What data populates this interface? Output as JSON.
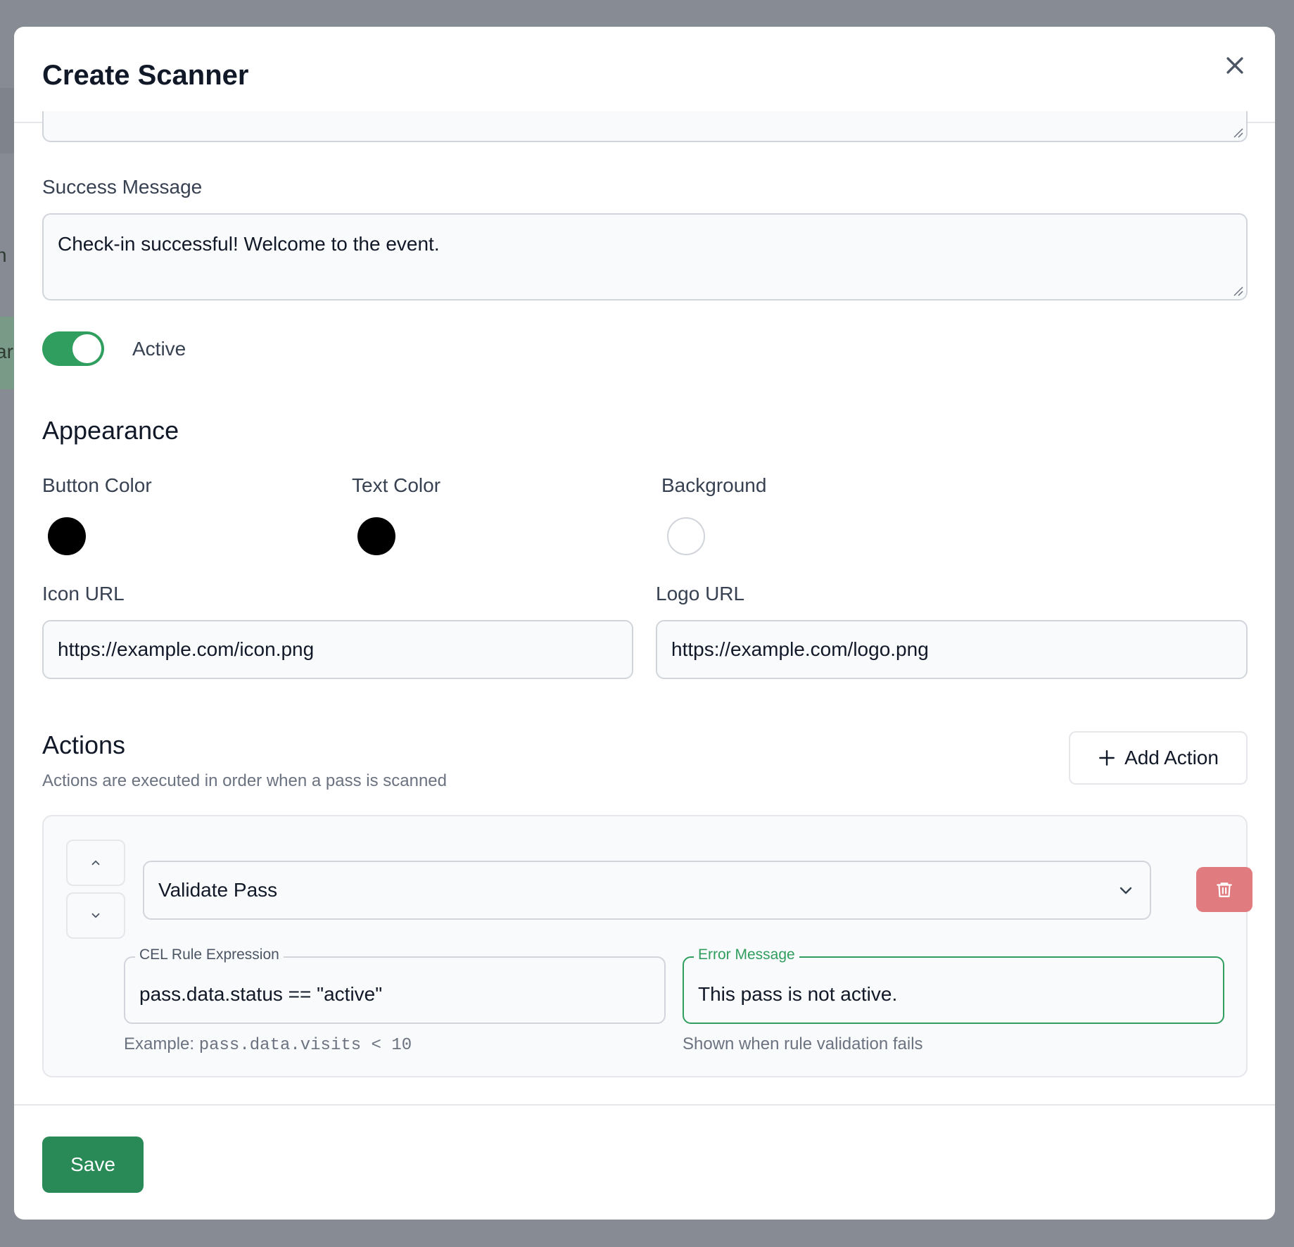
{
  "backdrop": {
    "fragment_1": "n",
    "fragment_2": "ar"
  },
  "modal": {
    "title": "Create Scanner",
    "close_icon": "close-icon"
  },
  "success_message": {
    "label": "Success Message",
    "value": "Check-in successful! Welcome to the event."
  },
  "active_toggle": {
    "label": "Active",
    "on": true,
    "color": "#2f9e5e"
  },
  "appearance": {
    "title": "Appearance",
    "button_color": {
      "label": "Button Color",
      "value": "#000000"
    },
    "text_color": {
      "label": "Text Color",
      "value": "#000000"
    },
    "background": {
      "label": "Background",
      "value": "#ffffff"
    },
    "icon_url": {
      "label": "Icon URL",
      "value": "https://example.com/icon.png"
    },
    "logo_url": {
      "label": "Logo URL",
      "value": "https://example.com/logo.png"
    }
  },
  "actions": {
    "title": "Actions",
    "subtitle": "Actions are executed in order when a pass is scanned",
    "add_button": "Add Action",
    "items": [
      {
        "type": "Validate Pass",
        "rule_label": "CEL Rule Expression",
        "rule_value": "pass.data.status == \"active\"",
        "rule_helper_prefix": "Example: ",
        "rule_helper_code": "pass.data.visits < 10",
        "error_label": "Error Message",
        "error_value": "This pass is not active.",
        "error_helper": "Shown when rule validation fails"
      }
    ]
  },
  "footer": {
    "save_label": "Save",
    "save_color": "#2a8a57"
  },
  "colors": {
    "delete": "#e07b80",
    "accent": "#2f9e5e"
  }
}
